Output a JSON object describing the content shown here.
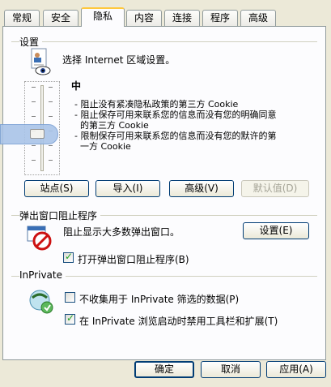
{
  "tabs": [
    "常规",
    "安全",
    "隐私",
    "内容",
    "连接",
    "程序",
    "高级"
  ],
  "active_tab": "隐私",
  "settings": {
    "group_label": "设置",
    "zone_instruction": "选择 Internet 区域设置。",
    "level_name": "中",
    "level_desc": [
      "- 阻止没有紧凑隐私政策的第三方 Cookie",
      "- 阻止保存可用来联系您的信息而没有您的明确同意",
      "  的第三方 Cookie",
      "- 限制保存可用来联系您的信息而没有您的默许的第",
      "  一方 Cookie"
    ],
    "buttons": {
      "sites": "站点(S)",
      "import": "导入(I)",
      "advanced": "高级(V)",
      "default": "默认值(D)"
    }
  },
  "popup": {
    "group_label": "弹出窗口阻止程序",
    "desc": "阻止显示大多数弹出窗口。",
    "settings_button": "设置(E)",
    "enable_label": "打开弹出窗口阻止程序(B)",
    "enable_checked": true
  },
  "inprivate": {
    "group_label": "InPrivate",
    "option1": "不收集用于 InPrivate 筛选的数据(P)",
    "option1_checked": false,
    "option2": "在 InPrivate 浏览启动时禁用工具栏和扩展(T)",
    "option2_checked": true
  },
  "footer": {
    "ok": "确定",
    "cancel": "取消",
    "apply": "应用(A)"
  },
  "colors": {
    "face": "#ece9d8",
    "panel": "#fcfcfe",
    "button_border": "#003c74",
    "tab_highlight": "#ffc83c"
  }
}
